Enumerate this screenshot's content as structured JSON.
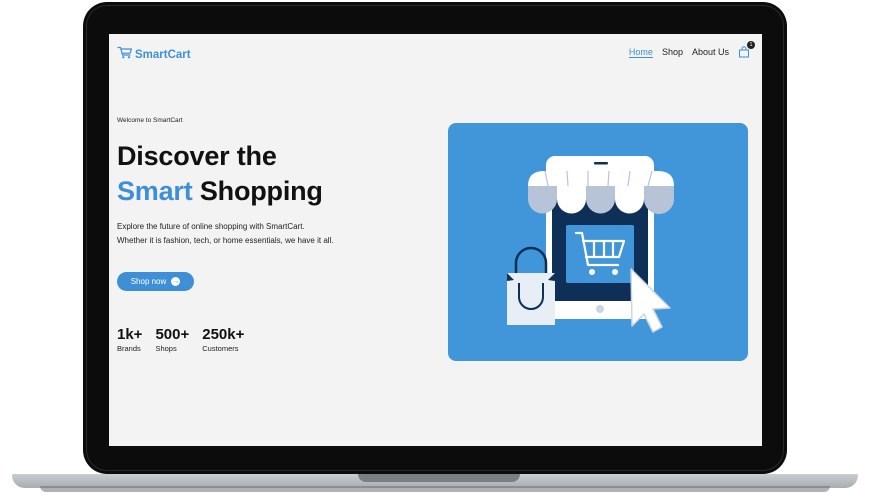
{
  "brand": {
    "name": "SmartCart"
  },
  "nav": {
    "home": "Home",
    "shop": "Shop",
    "about": "About Us",
    "cart_count": "1"
  },
  "hero": {
    "welcome": "Welcome to SmartCart",
    "headline_line1": "Discover the",
    "headline_accent": "Smart",
    "headline_rest": "Shopping",
    "desc_line1": "Explore the future of online shopping with SmartCart.",
    "desc_line2": "Whether it is fashion, tech, or home essentials, we have it all.",
    "cta": "Shop now"
  },
  "stats": [
    {
      "value": "1k+",
      "label": "Brands"
    },
    {
      "value": "500+",
      "label": "Shops"
    },
    {
      "value": "250k+",
      "label": "Customers"
    }
  ],
  "colors": {
    "accent": "#3f8fd6",
    "card_bg": "#4196da",
    "screen_bg": "#f3f3f4"
  },
  "icons": {
    "logo": "shopping-cart-icon",
    "cart": "shopping-bag-icon",
    "cta": "arrow-right-icon"
  }
}
